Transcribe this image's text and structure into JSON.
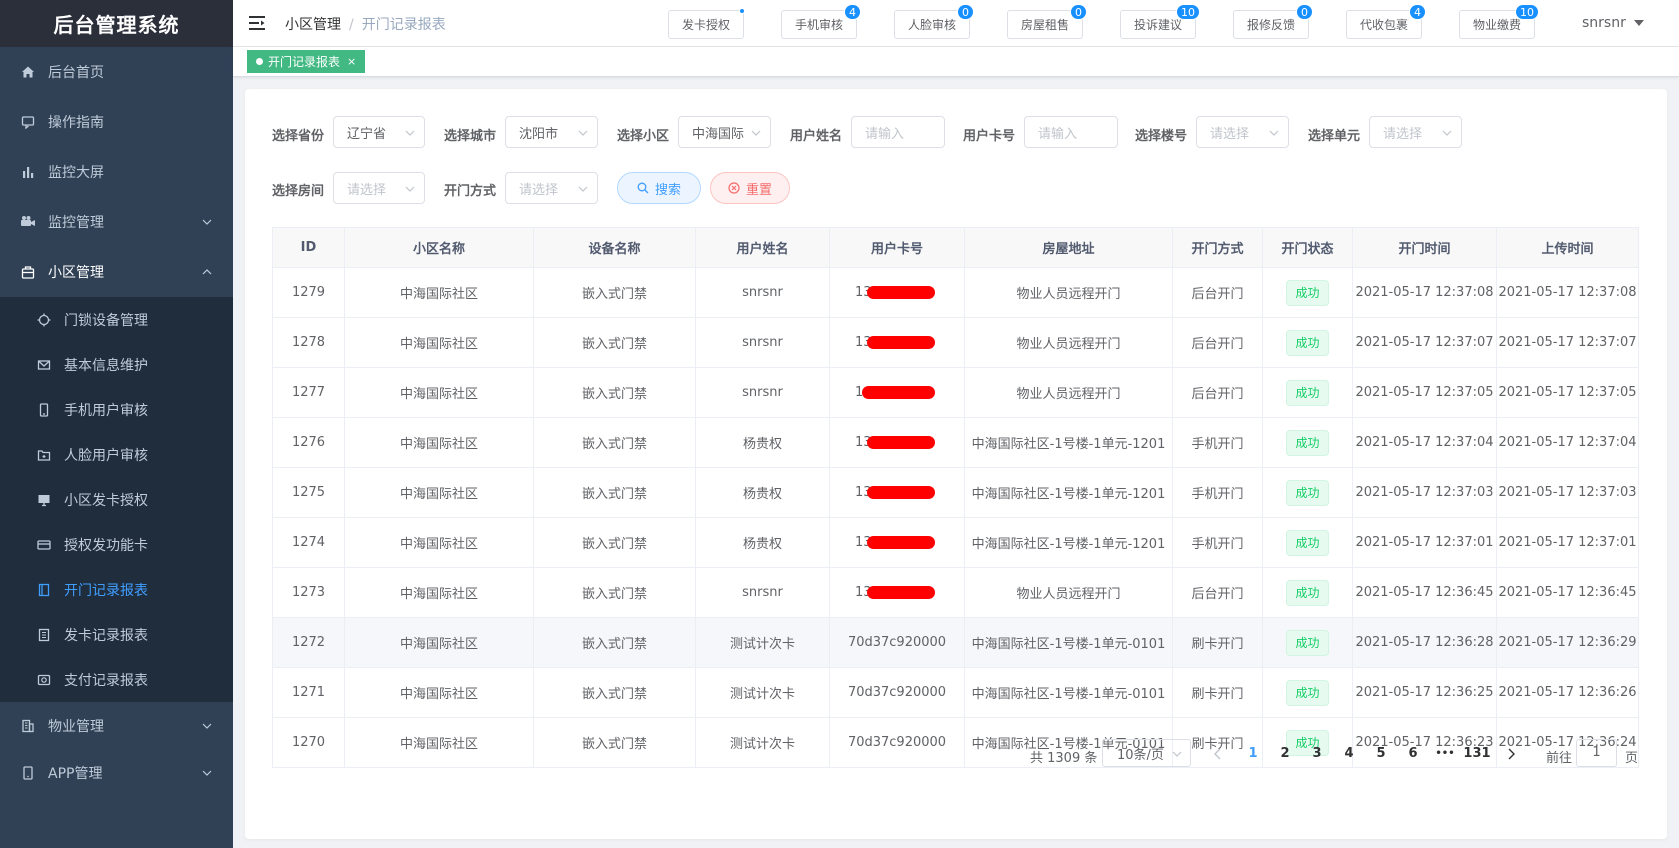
{
  "app": {
    "title": "后台管理系统"
  },
  "sidebar": {
    "items": [
      {
        "label": "后台首页",
        "icon": "home-icon"
      },
      {
        "label": "操作指南",
        "icon": "guide-icon"
      },
      {
        "label": "监控大屏",
        "icon": "chart-icon"
      },
      {
        "label": "监控管理",
        "icon": "camera-icon"
      },
      {
        "label": "小区管理",
        "icon": "building-icon"
      }
    ],
    "sub_items": [
      {
        "label": "门锁设备管理",
        "icon": "lock-device-icon"
      },
      {
        "label": "基本信息维护",
        "icon": "mail-icon"
      },
      {
        "label": "手机用户审核",
        "icon": "phone-icon"
      },
      {
        "label": "人脸用户审核",
        "icon": "face-icon"
      },
      {
        "label": "小区发卡授权",
        "icon": "monitor-icon"
      },
      {
        "label": "授权发功能卡",
        "icon": "card-icon"
      },
      {
        "label": "开门记录报表",
        "icon": "report-icon"
      },
      {
        "label": "发卡记录报表",
        "icon": "document-icon"
      },
      {
        "label": "支付记录报表",
        "icon": "payment-icon"
      }
    ],
    "bottom_items": [
      {
        "label": "物业管理",
        "icon": "office-icon"
      },
      {
        "label": "APP管理",
        "icon": "mobile-icon"
      }
    ]
  },
  "header": {
    "breadcrumb": [
      "小区管理",
      "开门记录报表"
    ],
    "buttons": [
      {
        "label": "发卡授权",
        "badge": ""
      },
      {
        "label": "手机审核",
        "badge": "4"
      },
      {
        "label": "人脸审核",
        "badge": "0"
      },
      {
        "label": "房屋租售",
        "badge": "0"
      },
      {
        "label": "投诉建议",
        "badge": "10"
      },
      {
        "label": "报修反馈",
        "badge": "0"
      },
      {
        "label": "代收包裹",
        "badge": "4"
      },
      {
        "label": "物业缴费",
        "badge": "10"
      }
    ],
    "user": "snrsnr"
  },
  "tags": {
    "active": "开门记录报表",
    "close": "×"
  },
  "filters": {
    "province": {
      "label": "选择省份",
      "value": "辽宁省"
    },
    "city": {
      "label": "选择城市",
      "value": "沈阳市"
    },
    "community": {
      "label": "选择小区",
      "value": "中海国际"
    },
    "username": {
      "label": "用户姓名",
      "placeholder": "请输入"
    },
    "card": {
      "label": "用户卡号",
      "placeholder": "请输入"
    },
    "building": {
      "label": "选择楼号",
      "placeholder": "请选择"
    },
    "unit": {
      "label": "选择单元",
      "placeholder": "请选择"
    },
    "room": {
      "label": "选择房间",
      "placeholder": "请选择"
    },
    "method": {
      "label": "开门方式",
      "placeholder": "请选择"
    },
    "search_label": "搜索",
    "reset_label": "重置"
  },
  "table": {
    "columns": [
      "ID",
      "小区名称",
      "设备名称",
      "用户姓名",
      "用户卡号",
      "房屋地址",
      "开门方式",
      "开门状态",
      "开门时间",
      "上传时间"
    ],
    "rows": [
      {
        "id": "1279",
        "community": "中海国际社区",
        "device": "嵌入式门禁",
        "user": "snrsnr",
        "card": "13",
        "address": "物业人员远程开门",
        "method": "后台开门",
        "status": "成功",
        "open_time": "2021-05-17 12:37:08",
        "upload_time": "2021-05-17 12:37:08"
      },
      {
        "id": "1278",
        "community": "中海国际社区",
        "device": "嵌入式门禁",
        "user": "snrsnr",
        "card": "13",
        "address": "物业人员远程开门",
        "method": "后台开门",
        "status": "成功",
        "open_time": "2021-05-17 12:37:07",
        "upload_time": "2021-05-17 12:37:07"
      },
      {
        "id": "1277",
        "community": "中海国际社区",
        "device": "嵌入式门禁",
        "user": "snrsnr",
        "card": "1",
        "address": "物业人员远程开门",
        "method": "后台开门",
        "status": "成功",
        "open_time": "2021-05-17 12:37:05",
        "upload_time": "2021-05-17 12:37:05"
      },
      {
        "id": "1276",
        "community": "中海国际社区",
        "device": "嵌入式门禁",
        "user": "杨贵权",
        "card": "13",
        "address": "中海国际社区-1号楼-1单元-1201",
        "method": "手机开门",
        "status": "成功",
        "open_time": "2021-05-17 12:37:04",
        "upload_time": "2021-05-17 12:37:04"
      },
      {
        "id": "1275",
        "community": "中海国际社区",
        "device": "嵌入式门禁",
        "user": "杨贵权",
        "card": "13",
        "address": "中海国际社区-1号楼-1单元-1201",
        "method": "手机开门",
        "status": "成功",
        "open_time": "2021-05-17 12:37:03",
        "upload_time": "2021-05-17 12:37:03"
      },
      {
        "id": "1274",
        "community": "中海国际社区",
        "device": "嵌入式门禁",
        "user": "杨贵权",
        "card": "13",
        "address": "中海国际社区-1号楼-1单元-1201",
        "method": "手机开门",
        "status": "成功",
        "open_time": "2021-05-17 12:37:01",
        "upload_time": "2021-05-17 12:37:01"
      },
      {
        "id": "1273",
        "community": "中海国际社区",
        "device": "嵌入式门禁",
        "user": "snrsnr",
        "card": "13",
        "address": "物业人员远程开门",
        "method": "后台开门",
        "status": "成功",
        "open_time": "2021-05-17 12:36:45",
        "upload_time": "2021-05-17 12:36:45"
      },
      {
        "id": "1272",
        "community": "中海国际社区",
        "device": "嵌入式门禁",
        "user": "测试计次卡",
        "card": "70d37c920000",
        "address": "中海国际社区-1号楼-1单元-0101",
        "method": "刷卡开门",
        "status": "成功",
        "open_time": "2021-05-17 12:36:28",
        "upload_time": "2021-05-17 12:36:29"
      },
      {
        "id": "1271",
        "community": "中海国际社区",
        "device": "嵌入式门禁",
        "user": "测试计次卡",
        "card": "70d37c920000",
        "address": "中海国际社区-1号楼-1单元-0101",
        "method": "刷卡开门",
        "status": "成功",
        "open_time": "2021-05-17 12:36:25",
        "upload_time": "2021-05-17 12:36:26"
      },
      {
        "id": "1270",
        "community": "中海国际社区",
        "device": "嵌入式门禁",
        "user": "测试计次卡",
        "card": "70d37c920000",
        "address": "中海国际社区-1号楼-1单元-0101",
        "method": "刷卡开门",
        "status": "成功",
        "open_time": "2021-05-17 12:36:23",
        "upload_time": "2021-05-17 12:36:24"
      }
    ]
  },
  "pagination": {
    "total_text": "共 1309 条",
    "page_size": "10条/页",
    "pages": [
      "1",
      "2",
      "3",
      "4",
      "5",
      "6",
      "•••",
      "131"
    ],
    "active_page": "1",
    "goto_label": "前往",
    "goto_value": "1",
    "page_suffix": "页"
  },
  "colors": {
    "sidebar_bg": "#304156",
    "submenu_bg": "#1f2d3d",
    "accent": "#409eff",
    "tag_green": "#42b983",
    "badge_blue": "#1890ff",
    "success": "#13ce66",
    "redaction": "#ff0000"
  }
}
